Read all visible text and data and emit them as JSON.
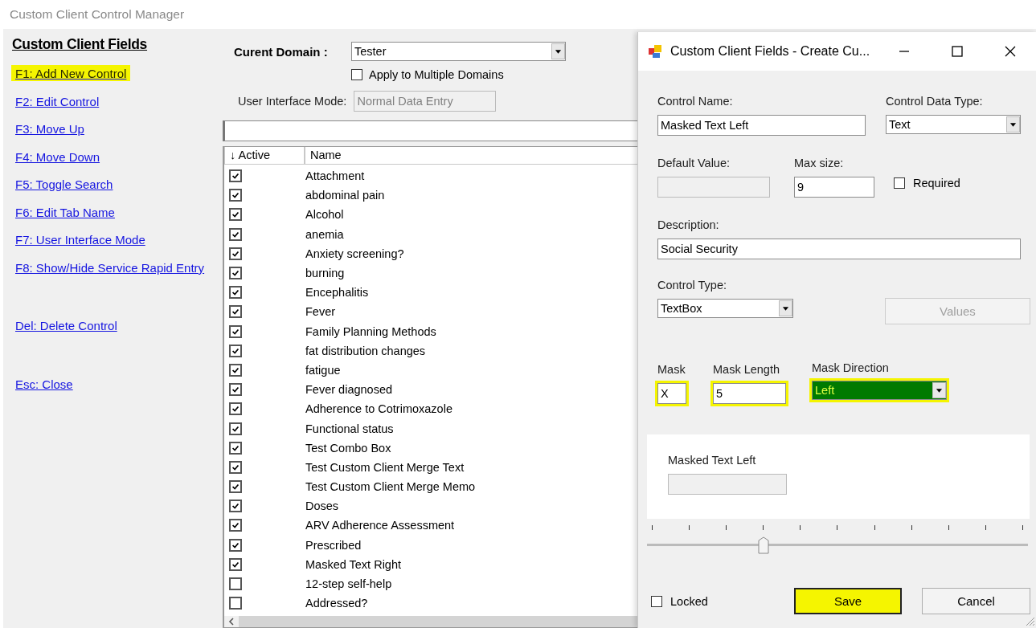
{
  "window": {
    "title": "Custom Client Control Manager"
  },
  "sidebar": {
    "heading": "Custom Client Fields",
    "sections": [
      {
        "links": [
          {
            "label": "F1: Add New Control",
            "highlighted": true
          },
          {
            "label": "F2: Edit Control",
            "highlighted": false
          },
          {
            "label": "F3: Move Up",
            "highlighted": false
          },
          {
            "label": "F4: Move Down",
            "highlighted": false
          },
          {
            "label": "F5: Toggle Search",
            "highlighted": false
          },
          {
            "label": "F6: Edit Tab Name",
            "highlighted": false
          },
          {
            "label": "F7: User Interface Mode",
            "highlighted": false
          },
          {
            "label": "F8: Show/Hide Service Rapid Entry",
            "highlighted": false
          }
        ]
      },
      {
        "links": [
          {
            "label": "Del: Delete Control",
            "highlighted": false
          }
        ]
      },
      {
        "links": [
          {
            "label": "Esc: Close",
            "highlighted": false
          }
        ]
      }
    ]
  },
  "domain": {
    "label": "Curent Domain :",
    "value": "Tester"
  },
  "apply_multiple": {
    "label": "Apply to Multiple Domains",
    "checked": false
  },
  "ui_mode": {
    "label": "User Interface Mode:",
    "value": "Normal Data Entry",
    "disabled": true
  },
  "list": {
    "columns": [
      "↓ Active",
      "Name"
    ],
    "rows": [
      {
        "active": true,
        "name": "Attachment"
      },
      {
        "active": true,
        "name": "abdominal pain"
      },
      {
        "active": true,
        "name": "Alcohol"
      },
      {
        "active": true,
        "name": "anemia"
      },
      {
        "active": true,
        "name": "Anxiety screening?"
      },
      {
        "active": true,
        "name": "burning"
      },
      {
        "active": true,
        "name": "Encephalitis"
      },
      {
        "active": true,
        "name": "Fever"
      },
      {
        "active": true,
        "name": "Family Planning Methods"
      },
      {
        "active": true,
        "name": "fat distribution changes"
      },
      {
        "active": true,
        "name": "fatigue"
      },
      {
        "active": true,
        "name": "Fever diagnosed"
      },
      {
        "active": true,
        "name": "Adherence to Cotrimoxazole"
      },
      {
        "active": true,
        "name": "Functional status"
      },
      {
        "active": true,
        "name": "Test Combo Box"
      },
      {
        "active": true,
        "name": "Test Custom Client Merge Text"
      },
      {
        "active": true,
        "name": "Test Custom Client Merge Memo"
      },
      {
        "active": true,
        "name": "Doses"
      },
      {
        "active": true,
        "name": "ARV Adherence Assessment"
      },
      {
        "active": true,
        "name": "Prescribed"
      },
      {
        "active": true,
        "name": "Masked Text Right"
      },
      {
        "active": false,
        "name": "12-step self-help"
      },
      {
        "active": false,
        "name": "Addressed?"
      }
    ]
  },
  "dialog": {
    "title": "Custom Client Fields - Create Cu...",
    "control_name": {
      "label": "Control Name:",
      "value": "Masked Text Left"
    },
    "control_data_type": {
      "label": "Control Data Type:",
      "value": "Text"
    },
    "default_value": {
      "label": "Default Value:",
      "disabled": true
    },
    "max_size": {
      "label": "Max size:",
      "value": "9"
    },
    "required": {
      "label": "Required",
      "checked": false
    },
    "description": {
      "label": "Description:",
      "value": "Social Security"
    },
    "control_type": {
      "label": "Control Type:",
      "value": "TextBox"
    },
    "values_button": {
      "label": "Values",
      "disabled": true
    },
    "mask": {
      "label": "Mask",
      "value": "X",
      "highlighted": true
    },
    "mask_length": {
      "label": "Mask Length",
      "value": "5",
      "highlighted": true
    },
    "mask_direction": {
      "label": "Mask Direction",
      "value": "Left",
      "highlighted": true
    },
    "preview": {
      "label": "Masked Text Left",
      "disabled": true
    },
    "slider": {
      "level": 0.3
    },
    "locked": {
      "label": "Locked",
      "checked": false
    },
    "save_button": {
      "label": "Save",
      "highlighted": true
    },
    "cancel_button": {
      "label": "Cancel",
      "highlighted": false
    }
  }
}
